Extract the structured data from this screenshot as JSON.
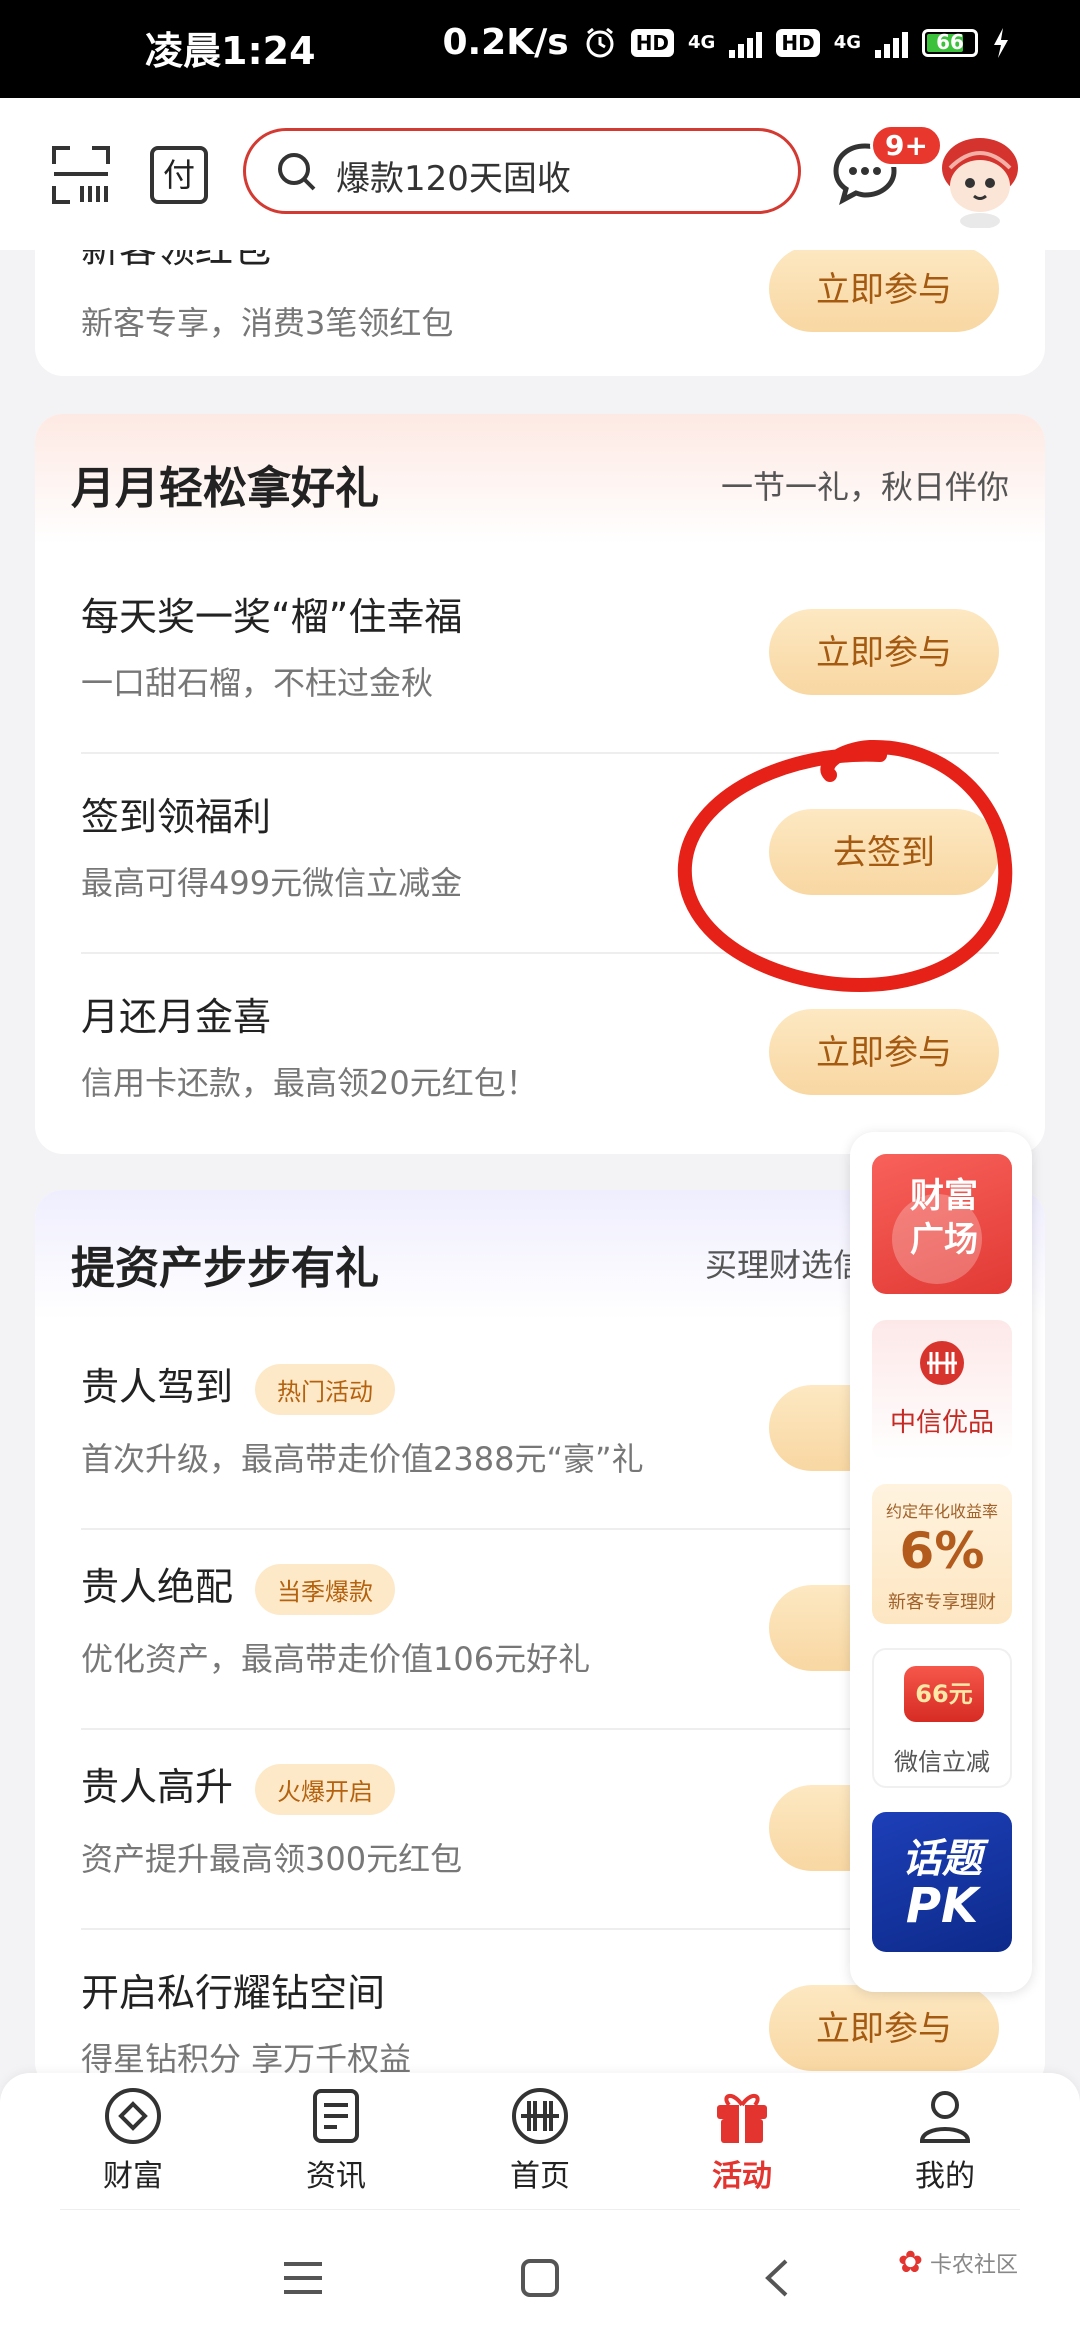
{
  "status": {
    "time": "凌晨1:24",
    "speed": "0.2K/s",
    "hd": "HD",
    "net": "4G",
    "battery": "66"
  },
  "header": {
    "search_placeholder": "爆款120天固收",
    "badge": "9+",
    "pay_label": "付"
  },
  "top_card": {
    "title": "新客领红包",
    "subtitle": "新客专享，消费3笔领红包",
    "button": "立即参与"
  },
  "monthly": {
    "heading": "月月轻松拿好礼",
    "aside": "一节一礼，秋日伴你",
    "items": [
      {
        "title": "每天奖一奖“榴”住幸福",
        "subtitle": "一口甜石榴，不枉过金秋",
        "button": "立即参与"
      },
      {
        "title": "签到领福利",
        "subtitle": "最高可得499元微信立减金",
        "button": "去签到"
      },
      {
        "title": "月还月金喜",
        "subtitle": "信用卡还款，最高领20元红包！",
        "button": "立即参与"
      }
    ]
  },
  "assets": {
    "heading": "提资产步步有礼",
    "aside": "买理财选信",
    "items": [
      {
        "title": "贵人驾到",
        "tag": "热门活动",
        "subtitle": "首次升级，最高带走价值2388元“豪”礼",
        "button": "立"
      },
      {
        "title": "贵人绝配",
        "tag": "当季爆款",
        "subtitle": "优化资产，最高带走价值106元好礼",
        "button": "立"
      },
      {
        "title": "贵人高升",
        "tag": "火爆开启",
        "subtitle": "资产提升最高领300元红包",
        "button": "立"
      },
      {
        "title": "开启私行耀钻空间",
        "subtitle": "得星钻积分 享万千权益",
        "button": "立即参与"
      }
    ]
  },
  "side": {
    "wealth_line1": "财富",
    "wealth_line2": "广场",
    "citic": "中信优品",
    "rate_top": "约定年化收益率",
    "rate_value": "6%",
    "rate_bottom": "新客专享理财",
    "wechat_amount": "66元",
    "wechat_label": "微信立减",
    "topic_line1": "话题",
    "topic_line2": "PK"
  },
  "nav": [
    {
      "label": "财富"
    },
    {
      "label": "资讯"
    },
    {
      "label": "首页"
    },
    {
      "label": "活动"
    },
    {
      "label": "我的"
    }
  ],
  "watermark": "卡农社区",
  "colors": {
    "accent": "#e3342f",
    "button_bg": "#f8d7a2",
    "button_text": "#a55a12"
  }
}
